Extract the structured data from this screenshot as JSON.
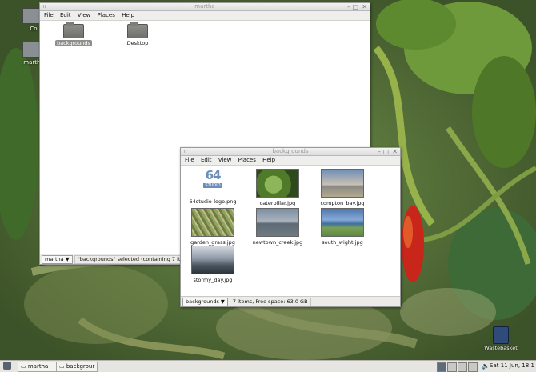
{
  "desktop": {
    "icons": [
      {
        "label": "Co"
      },
      {
        "label": "martha"
      }
    ],
    "trash_label": "Wastebasket"
  },
  "windows": {
    "martha": {
      "title": "martha",
      "menus": [
        "File",
        "Edit",
        "View",
        "Places",
        "Help"
      ],
      "items": [
        {
          "label": "backgrounds",
          "selected": true
        },
        {
          "label": "Desktop",
          "selected": false
        }
      ],
      "location": "martha",
      "status": "\"backgrounds\" selected (containing 7 it"
    },
    "backgrounds": {
      "title": "backgrounds",
      "menus": [
        "File",
        "Edit",
        "View",
        "Places",
        "Help"
      ],
      "items": [
        {
          "label": "64studio-logo.png",
          "logo_big": "64",
          "logo_small": "STUDIO"
        },
        {
          "label": "caterpillar.jpg"
        },
        {
          "label": "compton_bay.jpg"
        },
        {
          "label": "garden_grass.jpg"
        },
        {
          "label": "newtown_creek.jpg"
        },
        {
          "label": "south_wight.jpg"
        },
        {
          "label": "stormy_day.jpg"
        }
      ],
      "location": "backgrounds",
      "status": "7 items, Free space: 63.0 GB"
    }
  },
  "taskbar": {
    "buttons": [
      "martha",
      "backgrour"
    ],
    "clock": "Sat 11 Jun, 18:1"
  },
  "colors": {
    "selection": "#8f8f8b",
    "logo_blue": "#6b8db8"
  }
}
